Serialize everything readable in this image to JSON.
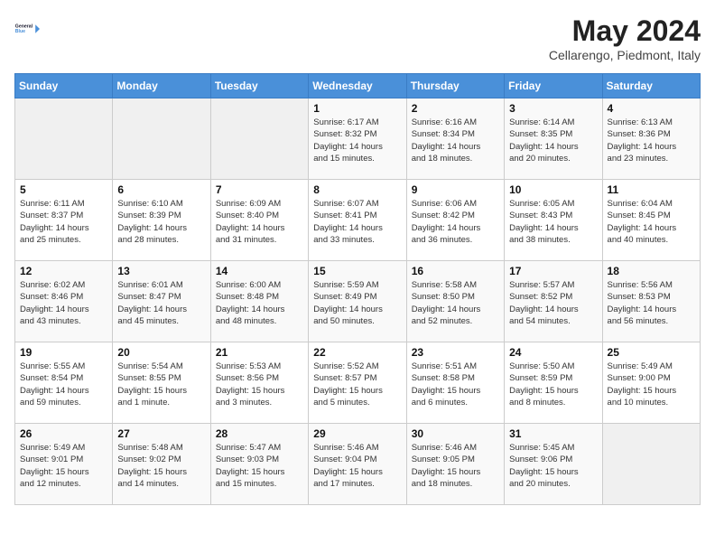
{
  "header": {
    "logo_line1": "General",
    "logo_line2": "Blue",
    "month": "May 2024",
    "location": "Cellarengo, Piedmont, Italy"
  },
  "weekdays": [
    "Sunday",
    "Monday",
    "Tuesday",
    "Wednesday",
    "Thursday",
    "Friday",
    "Saturday"
  ],
  "weeks": [
    [
      {
        "day": "",
        "info": ""
      },
      {
        "day": "",
        "info": ""
      },
      {
        "day": "",
        "info": ""
      },
      {
        "day": "1",
        "info": "Sunrise: 6:17 AM\nSunset: 8:32 PM\nDaylight: 14 hours\nand 15 minutes."
      },
      {
        "day": "2",
        "info": "Sunrise: 6:16 AM\nSunset: 8:34 PM\nDaylight: 14 hours\nand 18 minutes."
      },
      {
        "day": "3",
        "info": "Sunrise: 6:14 AM\nSunset: 8:35 PM\nDaylight: 14 hours\nand 20 minutes."
      },
      {
        "day": "4",
        "info": "Sunrise: 6:13 AM\nSunset: 8:36 PM\nDaylight: 14 hours\nand 23 minutes."
      }
    ],
    [
      {
        "day": "5",
        "info": "Sunrise: 6:11 AM\nSunset: 8:37 PM\nDaylight: 14 hours\nand 25 minutes."
      },
      {
        "day": "6",
        "info": "Sunrise: 6:10 AM\nSunset: 8:39 PM\nDaylight: 14 hours\nand 28 minutes."
      },
      {
        "day": "7",
        "info": "Sunrise: 6:09 AM\nSunset: 8:40 PM\nDaylight: 14 hours\nand 31 minutes."
      },
      {
        "day": "8",
        "info": "Sunrise: 6:07 AM\nSunset: 8:41 PM\nDaylight: 14 hours\nand 33 minutes."
      },
      {
        "day": "9",
        "info": "Sunrise: 6:06 AM\nSunset: 8:42 PM\nDaylight: 14 hours\nand 36 minutes."
      },
      {
        "day": "10",
        "info": "Sunrise: 6:05 AM\nSunset: 8:43 PM\nDaylight: 14 hours\nand 38 minutes."
      },
      {
        "day": "11",
        "info": "Sunrise: 6:04 AM\nSunset: 8:45 PM\nDaylight: 14 hours\nand 40 minutes."
      }
    ],
    [
      {
        "day": "12",
        "info": "Sunrise: 6:02 AM\nSunset: 8:46 PM\nDaylight: 14 hours\nand 43 minutes."
      },
      {
        "day": "13",
        "info": "Sunrise: 6:01 AM\nSunset: 8:47 PM\nDaylight: 14 hours\nand 45 minutes."
      },
      {
        "day": "14",
        "info": "Sunrise: 6:00 AM\nSunset: 8:48 PM\nDaylight: 14 hours\nand 48 minutes."
      },
      {
        "day": "15",
        "info": "Sunrise: 5:59 AM\nSunset: 8:49 PM\nDaylight: 14 hours\nand 50 minutes."
      },
      {
        "day": "16",
        "info": "Sunrise: 5:58 AM\nSunset: 8:50 PM\nDaylight: 14 hours\nand 52 minutes."
      },
      {
        "day": "17",
        "info": "Sunrise: 5:57 AM\nSunset: 8:52 PM\nDaylight: 14 hours\nand 54 minutes."
      },
      {
        "day": "18",
        "info": "Sunrise: 5:56 AM\nSunset: 8:53 PM\nDaylight: 14 hours\nand 56 minutes."
      }
    ],
    [
      {
        "day": "19",
        "info": "Sunrise: 5:55 AM\nSunset: 8:54 PM\nDaylight: 14 hours\nand 59 minutes."
      },
      {
        "day": "20",
        "info": "Sunrise: 5:54 AM\nSunset: 8:55 PM\nDaylight: 15 hours\nand 1 minute."
      },
      {
        "day": "21",
        "info": "Sunrise: 5:53 AM\nSunset: 8:56 PM\nDaylight: 15 hours\nand 3 minutes."
      },
      {
        "day": "22",
        "info": "Sunrise: 5:52 AM\nSunset: 8:57 PM\nDaylight: 15 hours\nand 5 minutes."
      },
      {
        "day": "23",
        "info": "Sunrise: 5:51 AM\nSunset: 8:58 PM\nDaylight: 15 hours\nand 6 minutes."
      },
      {
        "day": "24",
        "info": "Sunrise: 5:50 AM\nSunset: 8:59 PM\nDaylight: 15 hours\nand 8 minutes."
      },
      {
        "day": "25",
        "info": "Sunrise: 5:49 AM\nSunset: 9:00 PM\nDaylight: 15 hours\nand 10 minutes."
      }
    ],
    [
      {
        "day": "26",
        "info": "Sunrise: 5:49 AM\nSunset: 9:01 PM\nDaylight: 15 hours\nand 12 minutes."
      },
      {
        "day": "27",
        "info": "Sunrise: 5:48 AM\nSunset: 9:02 PM\nDaylight: 15 hours\nand 14 minutes."
      },
      {
        "day": "28",
        "info": "Sunrise: 5:47 AM\nSunset: 9:03 PM\nDaylight: 15 hours\nand 15 minutes."
      },
      {
        "day": "29",
        "info": "Sunrise: 5:46 AM\nSunset: 9:04 PM\nDaylight: 15 hours\nand 17 minutes."
      },
      {
        "day": "30",
        "info": "Sunrise: 5:46 AM\nSunset: 9:05 PM\nDaylight: 15 hours\nand 18 minutes."
      },
      {
        "day": "31",
        "info": "Sunrise: 5:45 AM\nSunset: 9:06 PM\nDaylight: 15 hours\nand 20 minutes."
      },
      {
        "day": "",
        "info": ""
      }
    ]
  ]
}
